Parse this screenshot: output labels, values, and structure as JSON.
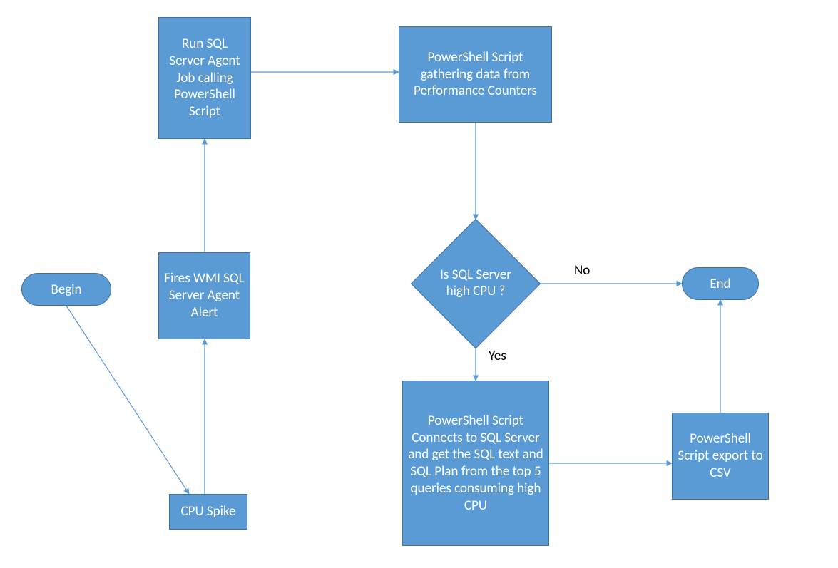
{
  "nodes": {
    "begin": "Begin",
    "cpu_spike": "CPU Spike",
    "wmi_alert": "Fires WMI SQL Server Agent Alert",
    "run_job": "Run SQL Server Agent Job calling PowerShell Script",
    "gather": "PowerShell Script gathering data from Performance Counters",
    "decision": "Is SQL Server high CPU ?",
    "connect": "PowerShell Script Connects to SQL Server and get the SQL text and SQL Plan from the top 5 queries consuming high CPU",
    "export": "PowerShell Script export to CSV",
    "end": "End"
  },
  "edge_labels": {
    "no": "No",
    "yes": "Yes"
  },
  "colors": {
    "fill": "#5b9bd5",
    "stroke": "#41719c",
    "text": "#ffffff",
    "label": "#000000",
    "bg": "#ffffff"
  }
}
